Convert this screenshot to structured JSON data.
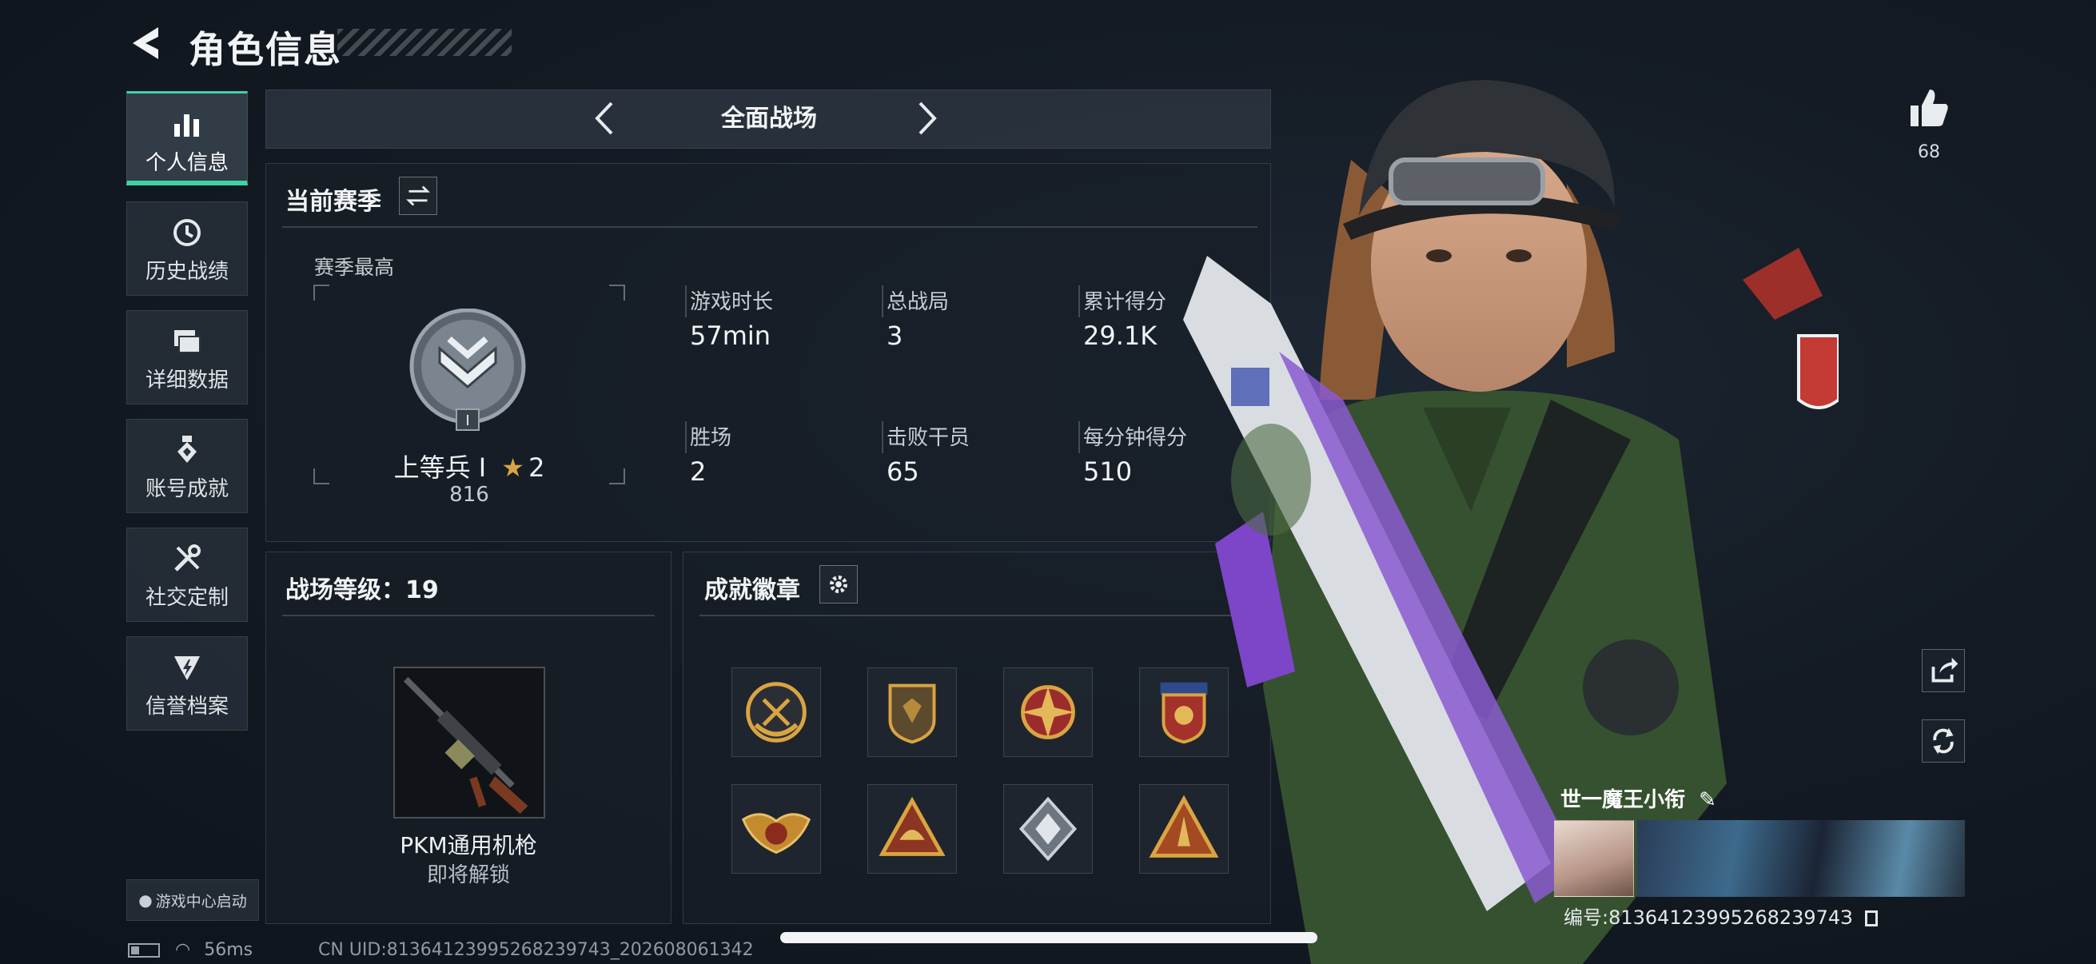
{
  "header": {
    "title": "角色信息"
  },
  "sidebar": {
    "items": [
      {
        "label": "个人信息",
        "icon": "bar-chart-icon",
        "active": true
      },
      {
        "label": "历史战绩",
        "icon": "clock-history-icon"
      },
      {
        "label": "详细数据",
        "icon": "folder-icon"
      },
      {
        "label": "账号成就",
        "icon": "medal-icon"
      },
      {
        "label": "社交定制",
        "icon": "tools-icon"
      },
      {
        "label": "信誉档案",
        "icon": "shield-bolt-icon"
      }
    ],
    "game_center": "游戏中心启动"
  },
  "mode_selector": {
    "label": "全面战场"
  },
  "season": {
    "title": "当前赛季",
    "best_label": "赛季最高",
    "rank_name": "上等兵 I",
    "rank_stars": "2",
    "rank_score": "816",
    "rank_badge_numeral": "I",
    "stats": [
      {
        "label": "游戏时长",
        "value": "57min"
      },
      {
        "label": "总战局",
        "value": "3"
      },
      {
        "label": "累计得分",
        "value": "29.1K"
      },
      {
        "label": "胜场",
        "value": "2"
      },
      {
        "label": "击败干员",
        "value": "65"
      },
      {
        "label": "每分钟得分",
        "value": "510"
      }
    ]
  },
  "battlefield_level": {
    "title": "战场等级：19",
    "weapon_name": "PKM通用机枪",
    "weapon_status": "即将解锁"
  },
  "achievements": {
    "title": "成就徽章",
    "badges": [
      {
        "icon": "skull-wing-badge-icon"
      },
      {
        "icon": "shield-badge-icon"
      },
      {
        "icon": "star-compass-badge-icon"
      },
      {
        "icon": "eagle-badge-icon"
      },
      {
        "icon": "winged-crest-badge-icon"
      },
      {
        "icon": "helmet-triangle-badge-icon"
      },
      {
        "icon": "gem-diamond-badge-icon"
      },
      {
        "icon": "rocket-triangle-badge-icon"
      }
    ]
  },
  "profile": {
    "likes": "68",
    "player_name": "世一魔王小衔",
    "player_id": "编号:8136412399526823974З"
  },
  "status_bar": {
    "ping": "56ms",
    "uid": "CN UID:81364123995268239743_202608061342"
  },
  "colors": {
    "accent": "#3fd3a3",
    "gold": "#d9a441",
    "panel_bg": "#181f27"
  }
}
